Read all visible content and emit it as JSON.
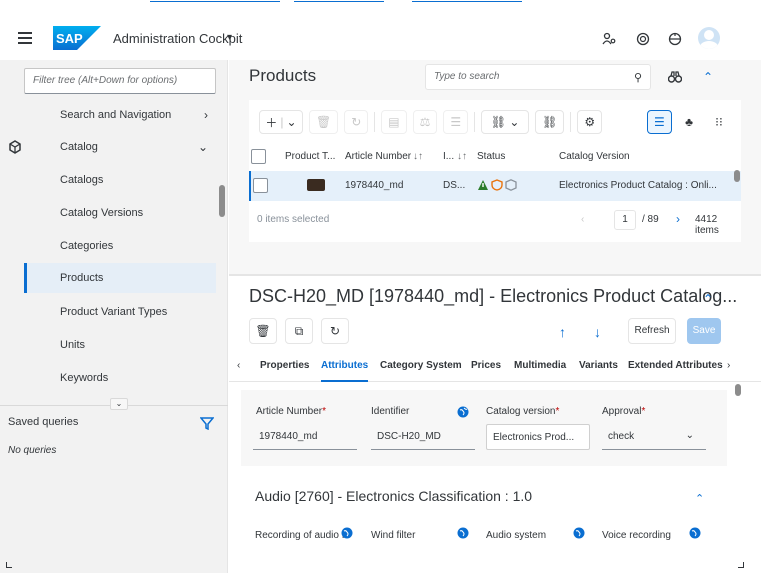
{
  "shell": {
    "app_title": "Administration Cockpit",
    "brand": "SAP"
  },
  "sidebar": {
    "filter_placeholder": "Filter tree (Alt+Down for options)",
    "items": [
      {
        "label": "Search and Navigation"
      },
      {
        "label": "Catalog"
      },
      {
        "label": "Catalogs"
      },
      {
        "label": "Catalog Versions"
      },
      {
        "label": "Categories"
      },
      {
        "label": "Products"
      },
      {
        "label": "Product Variant Types"
      },
      {
        "label": "Units"
      },
      {
        "label": "Keywords"
      }
    ],
    "saved_queries": "Saved queries",
    "no_queries": "No queries"
  },
  "products": {
    "title": "Products",
    "search_placeholder": "Type to search",
    "columns": [
      "Product T...",
      "Article Number",
      "I...",
      "Status",
      "Catalog Version"
    ],
    "sort_marks": [
      "↓↑",
      "↓↑"
    ],
    "row": {
      "article_number": "1978440_md",
      "identifier": "DS...",
      "catalog_version": "Electronics Product Catalog : Onli..."
    },
    "selected_text": "0 items selected",
    "page": "1",
    "page_total": "/ 89",
    "item_count": "4412 items"
  },
  "detail": {
    "title": "DSC-H20_MD [1978440_md] - Electronics Product Catalog...",
    "refresh_label": "Refresh",
    "save_label": "Save",
    "tabs": [
      "Properties",
      "Attributes",
      "Category System",
      "Prices",
      "Multimedia",
      "Variants",
      "Extended Attributes"
    ],
    "active_tab": "Attributes",
    "fields": [
      {
        "label": "Article Number",
        "required": "*",
        "value": "1978440_md"
      },
      {
        "label": "Identifier",
        "required": "",
        "value": "DSC-H20_MD"
      },
      {
        "label": "Catalog version",
        "required": "*",
        "value": "Electronics Prod..."
      },
      {
        "label": "Approval",
        "required": "*",
        "value": "check"
      }
    ],
    "section_title": "Audio [2760] - Electronics Classification : 1.0",
    "sub_fields": [
      "Recording of audio fil",
      "Wind filter",
      "Audio system",
      "Voice recording"
    ]
  },
  "colors": {
    "accent": "#0a6ed1",
    "warning": "#2b7d2b",
    "status_orange": "#e9730c",
    "sidebar_bg": "#f2f2f2",
    "active_item_bg": "#e5eef7"
  },
  "icons": [
    "menu-icon",
    "sap-logo",
    "user-switch-icon",
    "notifications-icon",
    "help-icon",
    "avatar-icon",
    "search-icon",
    "binoculars-icon",
    "collapse-icon",
    "add-icon",
    "delete-icon",
    "refresh-icon",
    "list-view-icon",
    "tree-view-icon",
    "grid-view-icon",
    "globe-icon"
  ]
}
